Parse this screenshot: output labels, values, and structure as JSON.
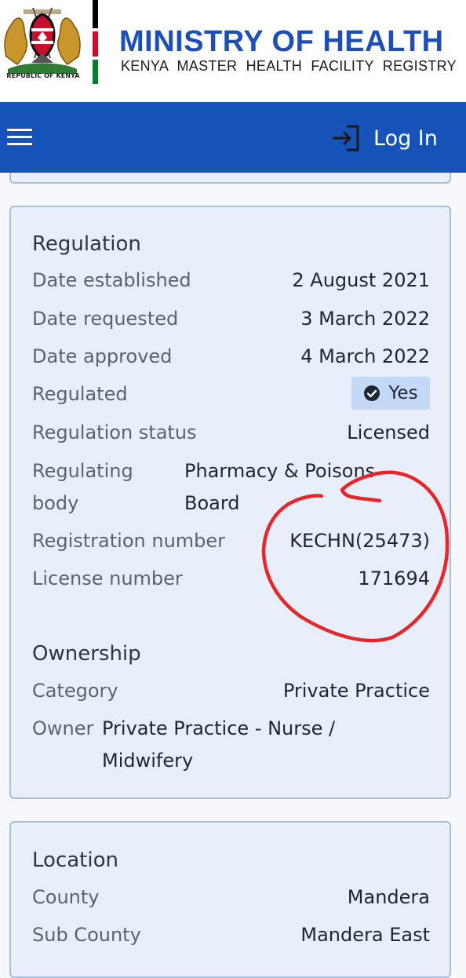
{
  "header": {
    "coat_caption": "REPUBLIC OF KENYA",
    "title": "MINISTRY OF HEALTH",
    "subtitle": "KENYA MASTER HEALTH FACILITY REGISTRY",
    "flag_colors": [
      "#000000",
      "#ffffff",
      "#c8102e",
      "#ffffff",
      "#0a7a2f"
    ]
  },
  "nav": {
    "menu_icon": "hamburger-menu-icon",
    "login_icon": "login-arrow-icon",
    "login_label": "Log In",
    "bar_color": "#1553b8"
  },
  "regulation": {
    "title": "Regulation",
    "date_established_label": "Date established",
    "date_established": "2 August 2021",
    "date_requested_label": "Date requested",
    "date_requested": "3 March 2022",
    "date_approved_label": "Date approved",
    "date_approved": "4 March 2022",
    "regulated_label": "Regulated",
    "regulated_value": "Yes",
    "regulated_icon": "check-circle-icon",
    "status_label": "Regulation status",
    "status_value": "Licensed",
    "body_label_line1": "Regulating",
    "body_label_line2": "body",
    "body_value_line1": "Pharmacy & Poisons",
    "body_value_line2": "Board",
    "registration_label": "Registration number",
    "registration_value": "KECHN(25473)",
    "license_label": "License number",
    "license_value": "171694",
    "annotation_color": "#e5262b"
  },
  "ownership": {
    "title": "Ownership",
    "category_label": "Category",
    "category_value": "Private Practice",
    "owner_label": "Owner",
    "owner_value_line1": "Private Practice - Nurse /",
    "owner_value_line2": "Midwifery"
  },
  "location": {
    "title": "Location",
    "county_label": "County",
    "county_value": "Mandera",
    "subcounty_label": "Sub County",
    "subcounty_value": "Mandera East"
  }
}
